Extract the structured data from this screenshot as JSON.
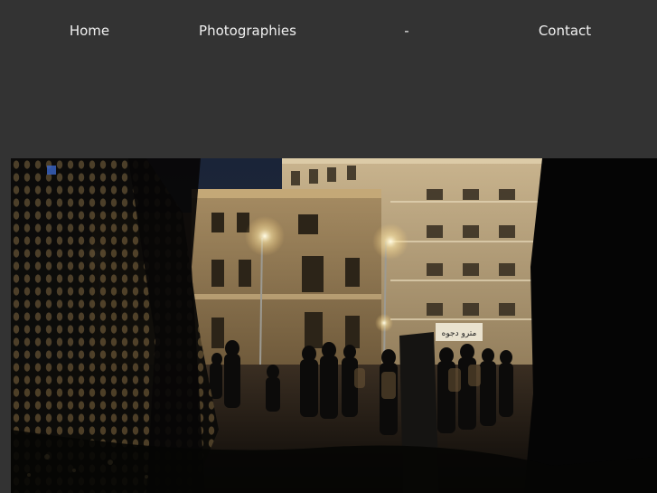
{
  "nav": {
    "items": [
      {
        "label": "Home"
      },
      {
        "label": "Photographies"
      },
      {
        "label": "-"
      },
      {
        "label": "Contact"
      }
    ]
  },
  "colors": {
    "background": "#333333",
    "nav_text": "#f0f0f0"
  },
  "photo": {
    "alt": "Night street scene with crowd in front of lit buildings",
    "sign_text": "مترو دجوه"
  }
}
